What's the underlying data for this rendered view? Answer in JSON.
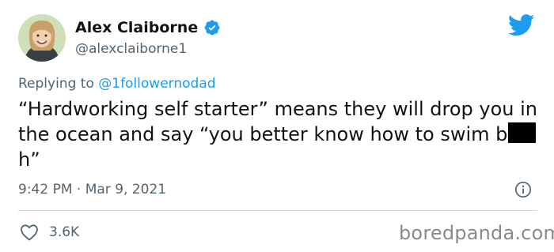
{
  "author": {
    "name": "Alex Claiborne",
    "handle": "@alexclaiborne1",
    "verified": true,
    "verified_icon": "verified-badge-icon",
    "avatar_icon": "avatar-photo"
  },
  "platform_icon": "twitter-bird-icon",
  "reply": {
    "prefix": "Replying to",
    "mention": "@1followernodad"
  },
  "tweet": {
    "text_before_redaction": "“Hardworking self starter” means they will drop you in the ocean and say “you better know how to swim b",
    "text_after_redaction": "h”"
  },
  "timestamp": "9:42 PM · Mar 9, 2021",
  "actions": {
    "likes_count": "3.6K",
    "like_icon": "heart-icon",
    "info_icon": "info-icon"
  },
  "watermark": "boredpanda.com",
  "colors": {
    "accent": "#1d9bf0",
    "text": "#0f1419",
    "secondary": "#536471",
    "divider": "#cfd9de"
  }
}
